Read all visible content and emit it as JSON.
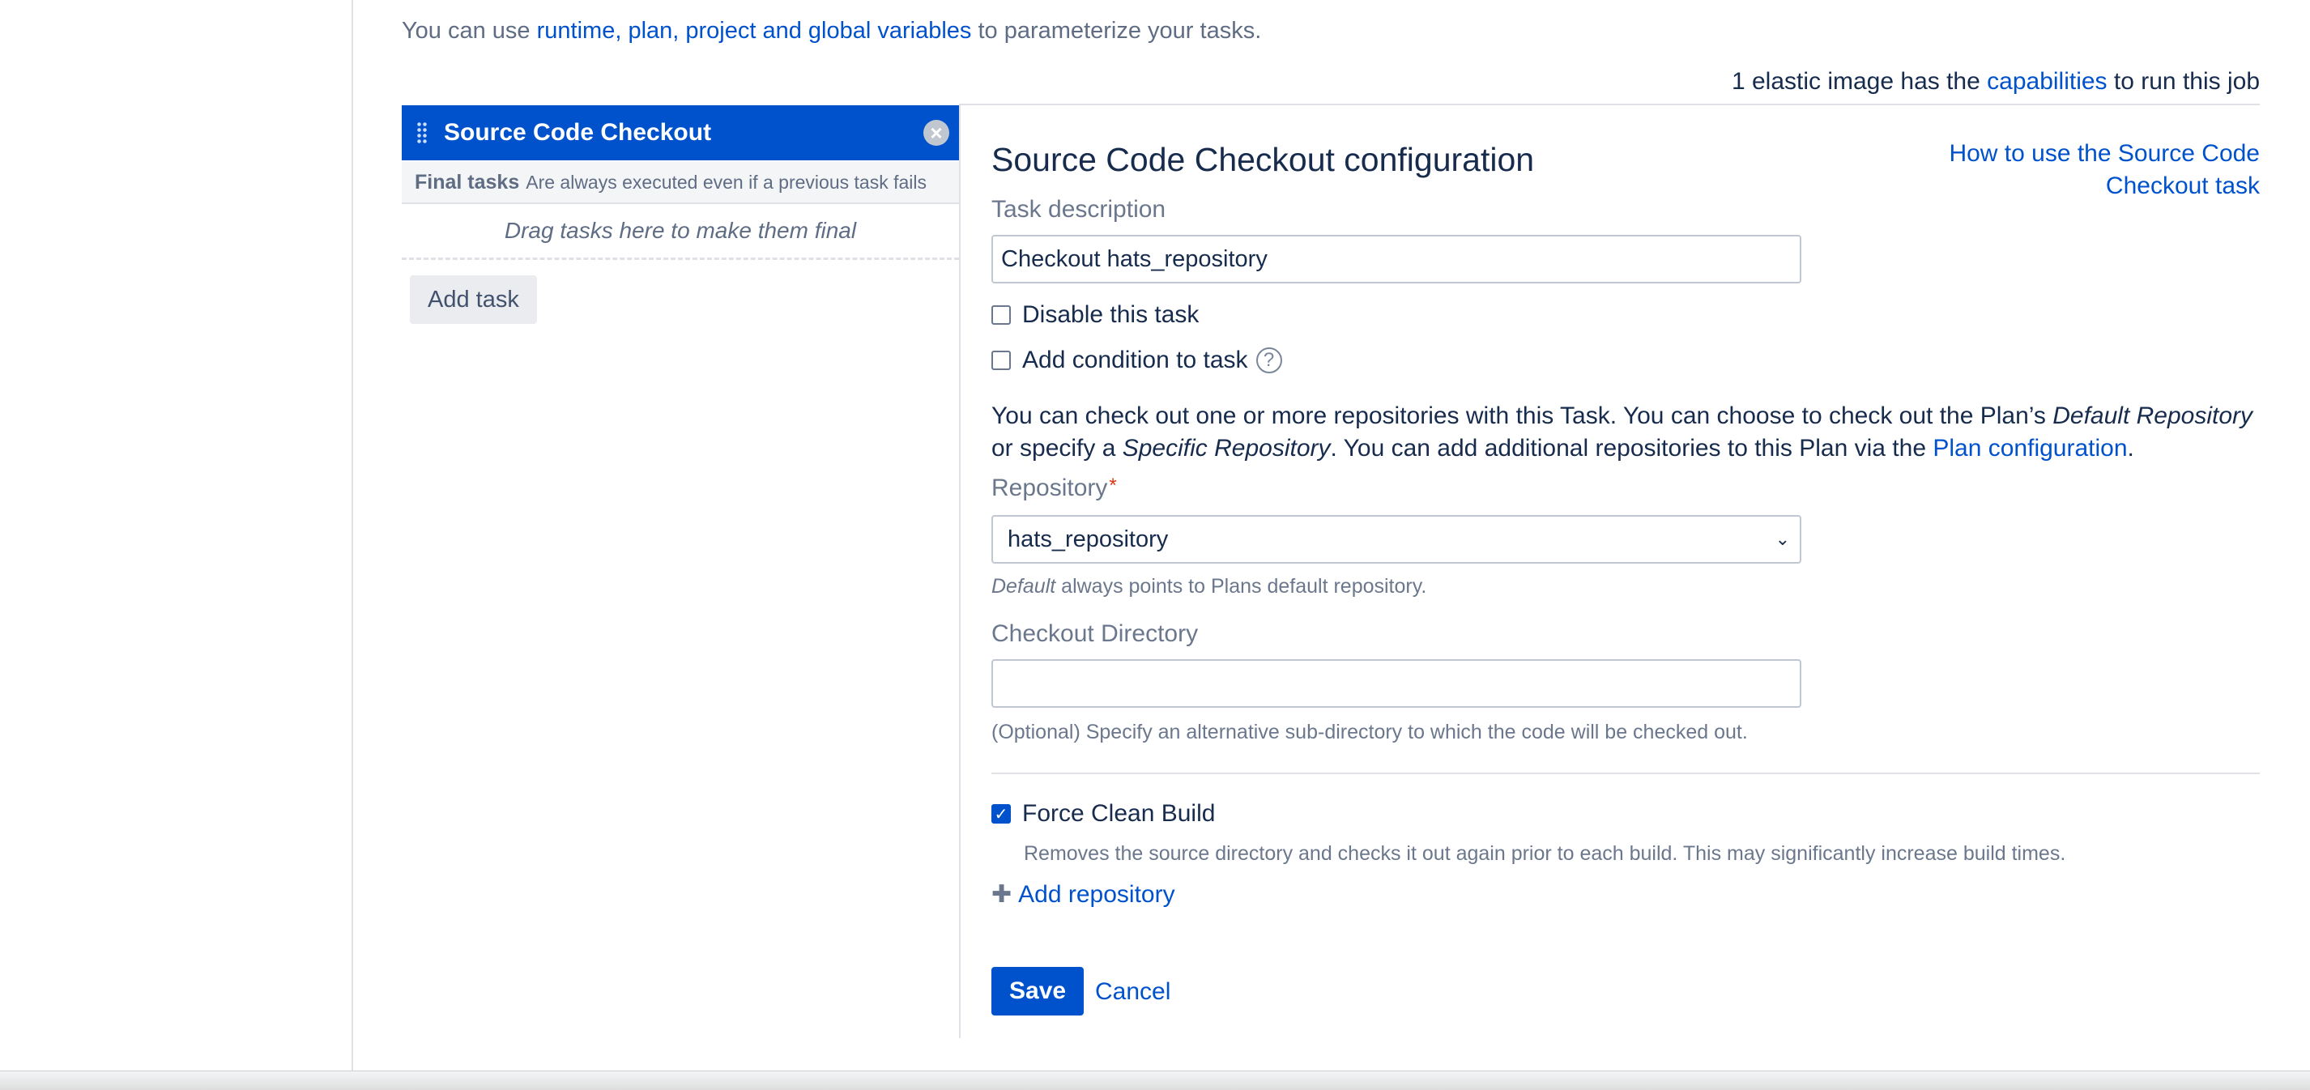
{
  "intro": {
    "prefix": "You can use ",
    "link": "runtime, plan, project and global variables",
    "suffix": " to parameterize your tasks."
  },
  "capabilities": {
    "prefix": "1 elastic image has the ",
    "link": "capabilities",
    "suffix": " to run this job"
  },
  "task_list": {
    "items": [
      {
        "label": "Source Code Checkout"
      }
    ],
    "final_tasks_title": "Final tasks",
    "final_tasks_desc": "Are always executed even if a previous task fails",
    "drop_hint": "Drag tasks here to make them final",
    "add_task_label": "Add task"
  },
  "config": {
    "title": "Source Code Checkout configuration",
    "help_link": "How to use the Source Code Checkout task",
    "task_description_label": "Task description",
    "task_description_value": "Checkout hats_repository",
    "disable_task_label": "Disable this task",
    "disable_task_checked": false,
    "add_condition_label": "Add condition to task",
    "add_condition_checked": false,
    "info": {
      "part1": "You can check out one or more repositories with this Task. You can choose to check out the Plan’s ",
      "em1": "Default Repository",
      "part2": " or specify a ",
      "em2": "Specific Repository",
      "part3": ". You can add additional repositories to this Plan via the ",
      "link": "Plan configuration",
      "part4": "."
    },
    "repository_label": "Repository",
    "repository_required_mark": "*",
    "repository_value": "hats_repository",
    "repository_hint_em": "Default",
    "repository_hint_rest": " always points to Plans default repository.",
    "checkout_dir_label": "Checkout Directory",
    "checkout_dir_value": "",
    "checkout_dir_hint": "(Optional) Specify an alternative sub-directory to which the code will be checked out.",
    "force_clean_label": "Force Clean Build",
    "force_clean_checked": true,
    "force_clean_hint": "Removes the source directory and checks it out again prior to each build. This may significantly increase build times.",
    "add_repository_label": "Add repository",
    "save_label": "Save",
    "cancel_label": "Cancel"
  },
  "icons": {
    "drag": "drag-handle-icon",
    "remove": "close-circle-icon",
    "help": "question-circle-icon",
    "add": "plus-icon",
    "chevron": "chevron-down-icon",
    "check": "checkmark-icon"
  },
  "colors": {
    "accent": "#0052cc",
    "text": "#172b4d",
    "subtle": "#6b778c",
    "required": "#de350b"
  }
}
